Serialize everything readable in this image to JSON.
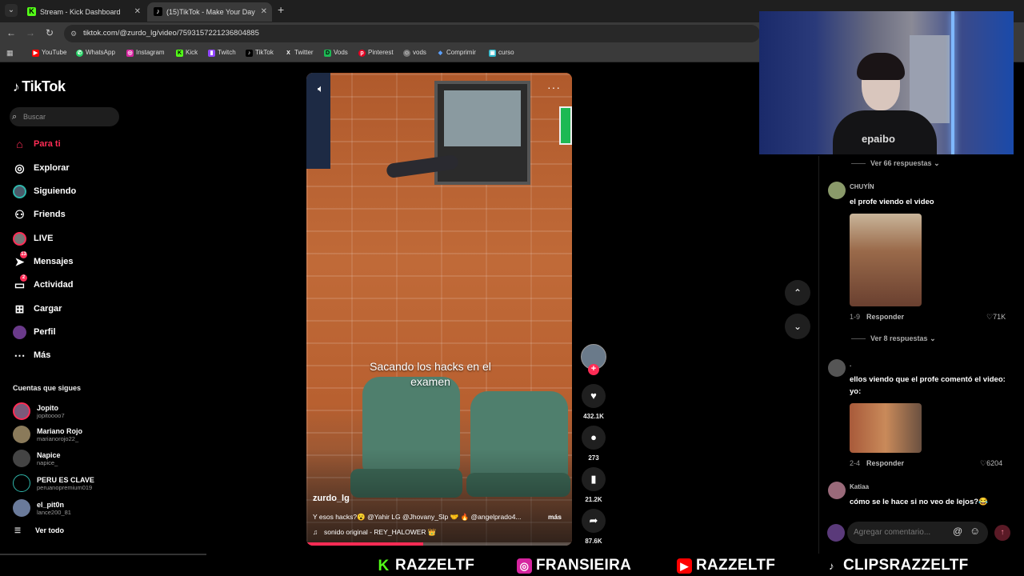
{
  "browser": {
    "tabs": [
      {
        "title": "Stream - Kick Dashboard",
        "favicon": "kick-icon"
      },
      {
        "title": "(15)TikTok - Make Your Day",
        "favicon": "tiktok-icon",
        "active": true
      }
    ],
    "url": "tiktok.com/@zurdo_lg/video/7593157221236804885",
    "bookmarks": [
      "YouTube",
      "WhatsApp",
      "Instagram",
      "Kick",
      "Twitch",
      "TikTok",
      "Twitter",
      "Vods",
      "Pinterest",
      "vods",
      "Comprimir",
      "curso"
    ]
  },
  "sidebar": {
    "logo": "TikTok",
    "search_placeholder": "Buscar",
    "nav": [
      {
        "label": "Para ti",
        "icon": "home-icon",
        "active": true
      },
      {
        "label": "Explorar",
        "icon": "compass-icon"
      },
      {
        "label": "Siguiendo",
        "icon": "following-avatar-icon"
      },
      {
        "label": "Friends",
        "icon": "friends-icon"
      },
      {
        "label": "LIVE",
        "icon": "live-icon"
      },
      {
        "label": "Mensajes",
        "icon": "messages-icon",
        "badge": "13"
      },
      {
        "label": "Actividad",
        "icon": "activity-icon",
        "badge": "2"
      },
      {
        "label": "Cargar",
        "icon": "upload-icon"
      },
      {
        "label": "Perfil",
        "icon": "profile-avatar-icon"
      },
      {
        "label": "Más",
        "icon": "more-icon"
      }
    ],
    "following_title": "Cuentas que sigues",
    "following": [
      {
        "name": "Jopito",
        "handle": "jopitoooo7"
      },
      {
        "name": "Mariano Rojo",
        "handle": "marianorojo22_"
      },
      {
        "name": "Napice",
        "handle": "napice_"
      },
      {
        "name": "PERU ES CLAVE",
        "handle": "peruanopremium019"
      },
      {
        "name": "el_pit0n",
        "handle": "lance200_81"
      }
    ],
    "see_all": "Ver todo"
  },
  "video": {
    "caption": "Sacando los hacks en el examen",
    "username": "zurdo_lg",
    "description": "Y esos hacks?😮 @Yahir LG @Jhovany_Slp 🤝 🔥 @angelprado4...",
    "more": "más",
    "sound": "sonido original - REY_HALOWER 👑",
    "progress": 0.44
  },
  "actions": {
    "likes": "432.1K",
    "comments": "273",
    "saves": "21.2K",
    "shares": "87.6K"
  },
  "comments": {
    "thread1_replies": "Ver 66 respuestas",
    "items": [
      {
        "name": "CHUYÍN",
        "text": "el profe viendo el video",
        "date": "1-9",
        "reply": "Responder",
        "likes": "71K",
        "replies": "Ver 8 respuestas"
      },
      {
        "name": ".",
        "text": "ellos viendo que el profe comentó el video: yo:",
        "date": "2-4",
        "reply": "Responder",
        "likes": "6204"
      },
      {
        "name": "Katiaa",
        "text": "cómo se le hace si no veo de lejos?😂"
      }
    ],
    "input_placeholder": "Agregar comentario..."
  },
  "stream_footer": [
    {
      "icon": "kick-icon",
      "label": "RAZZELTF",
      "color": "#53fc18"
    },
    {
      "icon": "instagram-icon",
      "label": "FRANSIEIRA",
      "color": "#e1306c"
    },
    {
      "icon": "youtube-icon",
      "label": "RAZZELTF",
      "color": "#ff0000"
    },
    {
      "icon": "tiktok-icon",
      "label": "CLIPSRAZZELTF",
      "color": "#ffffff"
    }
  ],
  "webcam": {
    "shirt_text": "epaibo"
  }
}
